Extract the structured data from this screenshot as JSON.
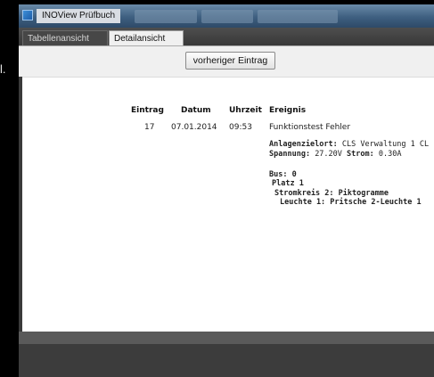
{
  "left_fragment": "l.",
  "window": {
    "title": "INOView Prüfbuch"
  },
  "tabs": [
    {
      "label": "Tabellenansicht",
      "active": false
    },
    {
      "label": "Detailansicht",
      "active": true
    }
  ],
  "toolbar": {
    "prev_label": "vorheriger Eintrag"
  },
  "table": {
    "headers": {
      "eintrag": "Eintrag",
      "datum": "Datum",
      "uhrzeit": "Uhrzeit",
      "ereignis": "Ereignis"
    },
    "row": {
      "eintrag": "17",
      "datum": "07.01.2014",
      "uhrzeit": "09:53",
      "ereignis": "Funktionstest Fehler"
    }
  },
  "details": {
    "anlagenzielort_label": "Anlagenzielort:",
    "anlagenzielort_value": "CLS Verwaltung 1 CL",
    "spannung_label": "Spannung:",
    "spannung_value": "27.20V",
    "strom_label": "Strom:",
    "strom_value": "0.30A",
    "bus": "Bus: 0",
    "platz": "Platz 1",
    "stromkreis": "Stromkreis 2: Piktogramme",
    "leuchte": "Leuchte 1: Pritsche 2-Leuchte 1"
  }
}
